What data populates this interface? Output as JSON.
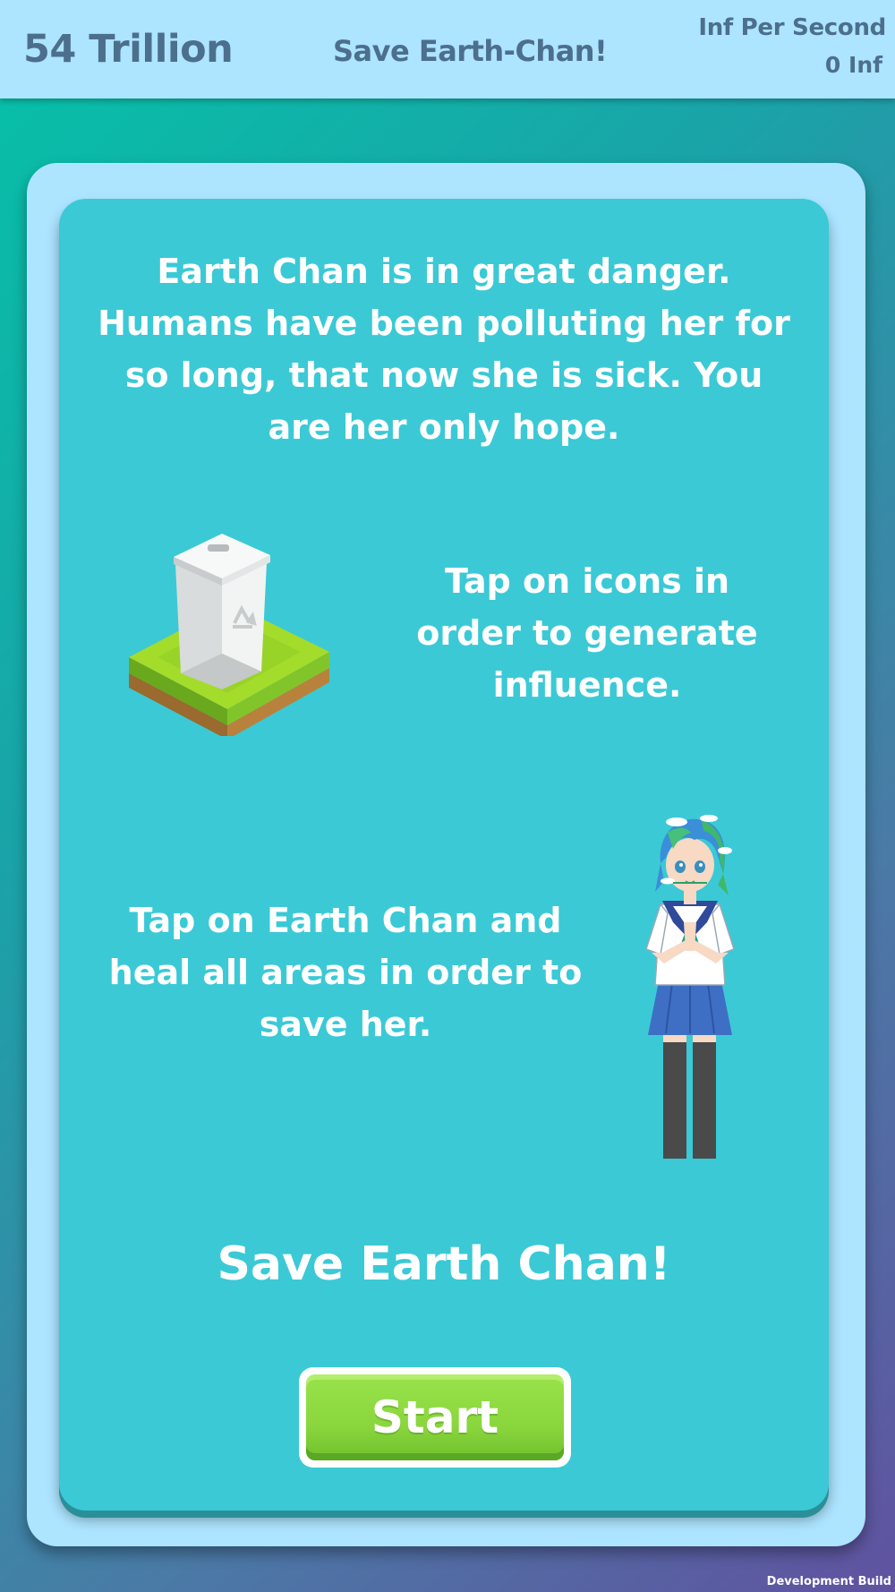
{
  "header": {
    "currency_amount": "54 Trillion",
    "title": "Save Earth-Chan!",
    "rate_label": "Inf Per Second",
    "rate_value": "0 Inf"
  },
  "panel": {
    "intro_text": "Earth Chan is in great danger. Humans have been polluting her for so long, that now she is sick. You are her only hope.",
    "tip_icons": "Tap on icons in order to generate influence.",
    "tip_earthchan": "Tap on Earth Chan and heal all areas in order to save her.",
    "call_to_action": "Save Earth Chan!",
    "start_label": "Start",
    "icons": {
      "recycle_bin": "recycle-bin-icon",
      "earth_chan": "earth-chan-character"
    }
  },
  "footer": {
    "build_label": "Development Build"
  },
  "colors": {
    "header_bg": "#ade4ff",
    "header_text": "#4b6f8d",
    "panel_frame": "#ade4ff",
    "panel_fill": "#3bc9d6",
    "button_green": "#8ad63d"
  }
}
